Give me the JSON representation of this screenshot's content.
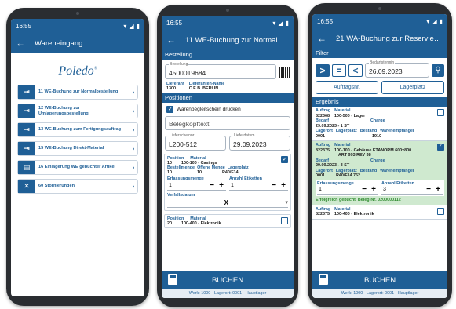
{
  "phone1": {
    "time": "16:55",
    "title": "Wareneingang",
    "logo": "Poledo",
    "logo_mark": "®",
    "menu": [
      {
        "label": "11 WE-Buchung zur Normalbestellung"
      },
      {
        "label": "12 WE-Buchung zur Umlagerungsbestellung"
      },
      {
        "label": "13 WE-Buchung zum Fertigungsauftrag"
      },
      {
        "label": "15 WE-Buchung Direkt-Material"
      },
      {
        "label": "16 Einlagerung WE gebuchter Artikel"
      },
      {
        "label": "60 Stornierungen"
      }
    ]
  },
  "phone2": {
    "time": "16:55",
    "title": "11 WE-Buchung zur Normalbeste...",
    "sec_bestellung": "Bestellung",
    "bestellung_label": "Bestellung",
    "bestellung_value": "4500019684",
    "lieferant_label": "Lieferant",
    "lieferant_value": "1300",
    "lieferantenname_label": "Lieferanten-Name",
    "lieferantenname_value": "C.E.B. BERLIN",
    "sec_positionen": "Positionen",
    "warenbegleitschein": "Warenbegleitschein drucken",
    "belegkopftext": "Belegkopftext",
    "lieferschein_label": "Lieferscheinnr.",
    "lieferschein_value": "L200-512",
    "lieferdatum_label": "Lieferdatum",
    "lieferdatum_value": "29.09.2023",
    "pos1": {
      "h_position": "Position",
      "h_material": "Material",
      "position": "10",
      "material": "100-100 - Casings",
      "h_bestellmenge": "Bestellmenge",
      "h_offene": "Offene Menge",
      "h_lagerplatz": "Lagerplatz",
      "bestellmenge": "10",
      "offene": "10",
      "lagerplatz": "R40/F14",
      "erfassungsmenge_label": "Erfassungsmenge",
      "erfassungsmenge": "1",
      "etiketten_label": "Anzahl Etiketten",
      "etiketten": "1",
      "verfall_label": "Verfallsdatum",
      "verfall_value": "X"
    },
    "pos2": {
      "h_position": "Position",
      "h_material": "Material",
      "position": "20",
      "material": "100-400 - Elektronik"
    },
    "button": "BUCHEN",
    "footer": "Werk: 1000 - Lagerort: 0001 - Hauptlager"
  },
  "phone3": {
    "time": "16:55",
    "title": "21 WA-Buchung zur Reservierung",
    "sec_filter": "Filter",
    "op_gt": ">",
    "op_eq": "=",
    "op_lt": "<",
    "bedarf_label": "Bedarfstermin",
    "bedarf_value": "26.09.2023",
    "btn_auftrag": "Auftragsnr.",
    "btn_lagerplatz": "Lagerplatz",
    "sec_ergebnis": "Ergebnis",
    "r1": {
      "h_auftrag": "Auftrag",
      "h_material": "Material",
      "auftrag": "822368",
      "material": "100-500 - Lager",
      "h_bedarf": "Bedarf",
      "h_charge": "Charge",
      "bedarf": "29.09.2023 - 1 ST",
      "h_lagerort": "Lagerort",
      "h_lagerplatz": "Lagerplatz",
      "h_bestand": "Bestand",
      "h_empf": "Warenempfänger",
      "lagerort": "0001",
      "bestand": "1910"
    },
    "r2": {
      "h_auftrag": "Auftrag",
      "h_material": "Material",
      "auftrag": "822375",
      "material": "100-100 - Gehäuse ETANORM 600x800",
      "material2": "ART 993 REV 38",
      "h_bedarf": "Bedarf",
      "h_charge": "Charge",
      "bedarf": "29.09.2023 - 3 ST",
      "h_lagerort": "Lagerort",
      "h_lagerplatz": "Lagerplatz",
      "h_bestand": "Bestand",
      "h_empf": "Warenempfänger",
      "lagerort": "0001",
      "lagerplatz": "R40/F14",
      "bestand": "752",
      "erfassungsmenge_label": "Erfassungsmenge",
      "erfassungsmenge": "1",
      "etiketten_label": "Anzahl Etiketten",
      "etiketten": "3",
      "success": "Erfolgreich gebucht. Beleg-Nr. 0200000112"
    },
    "r3": {
      "h_auftrag": "Auftrag",
      "h_material": "Material",
      "auftrag": "822375",
      "material": "100-400 - Elektronik"
    },
    "button": "BUCHEN",
    "footer": "Werk: 1000 - Lagerort: 0001 - Hauptlager"
  }
}
